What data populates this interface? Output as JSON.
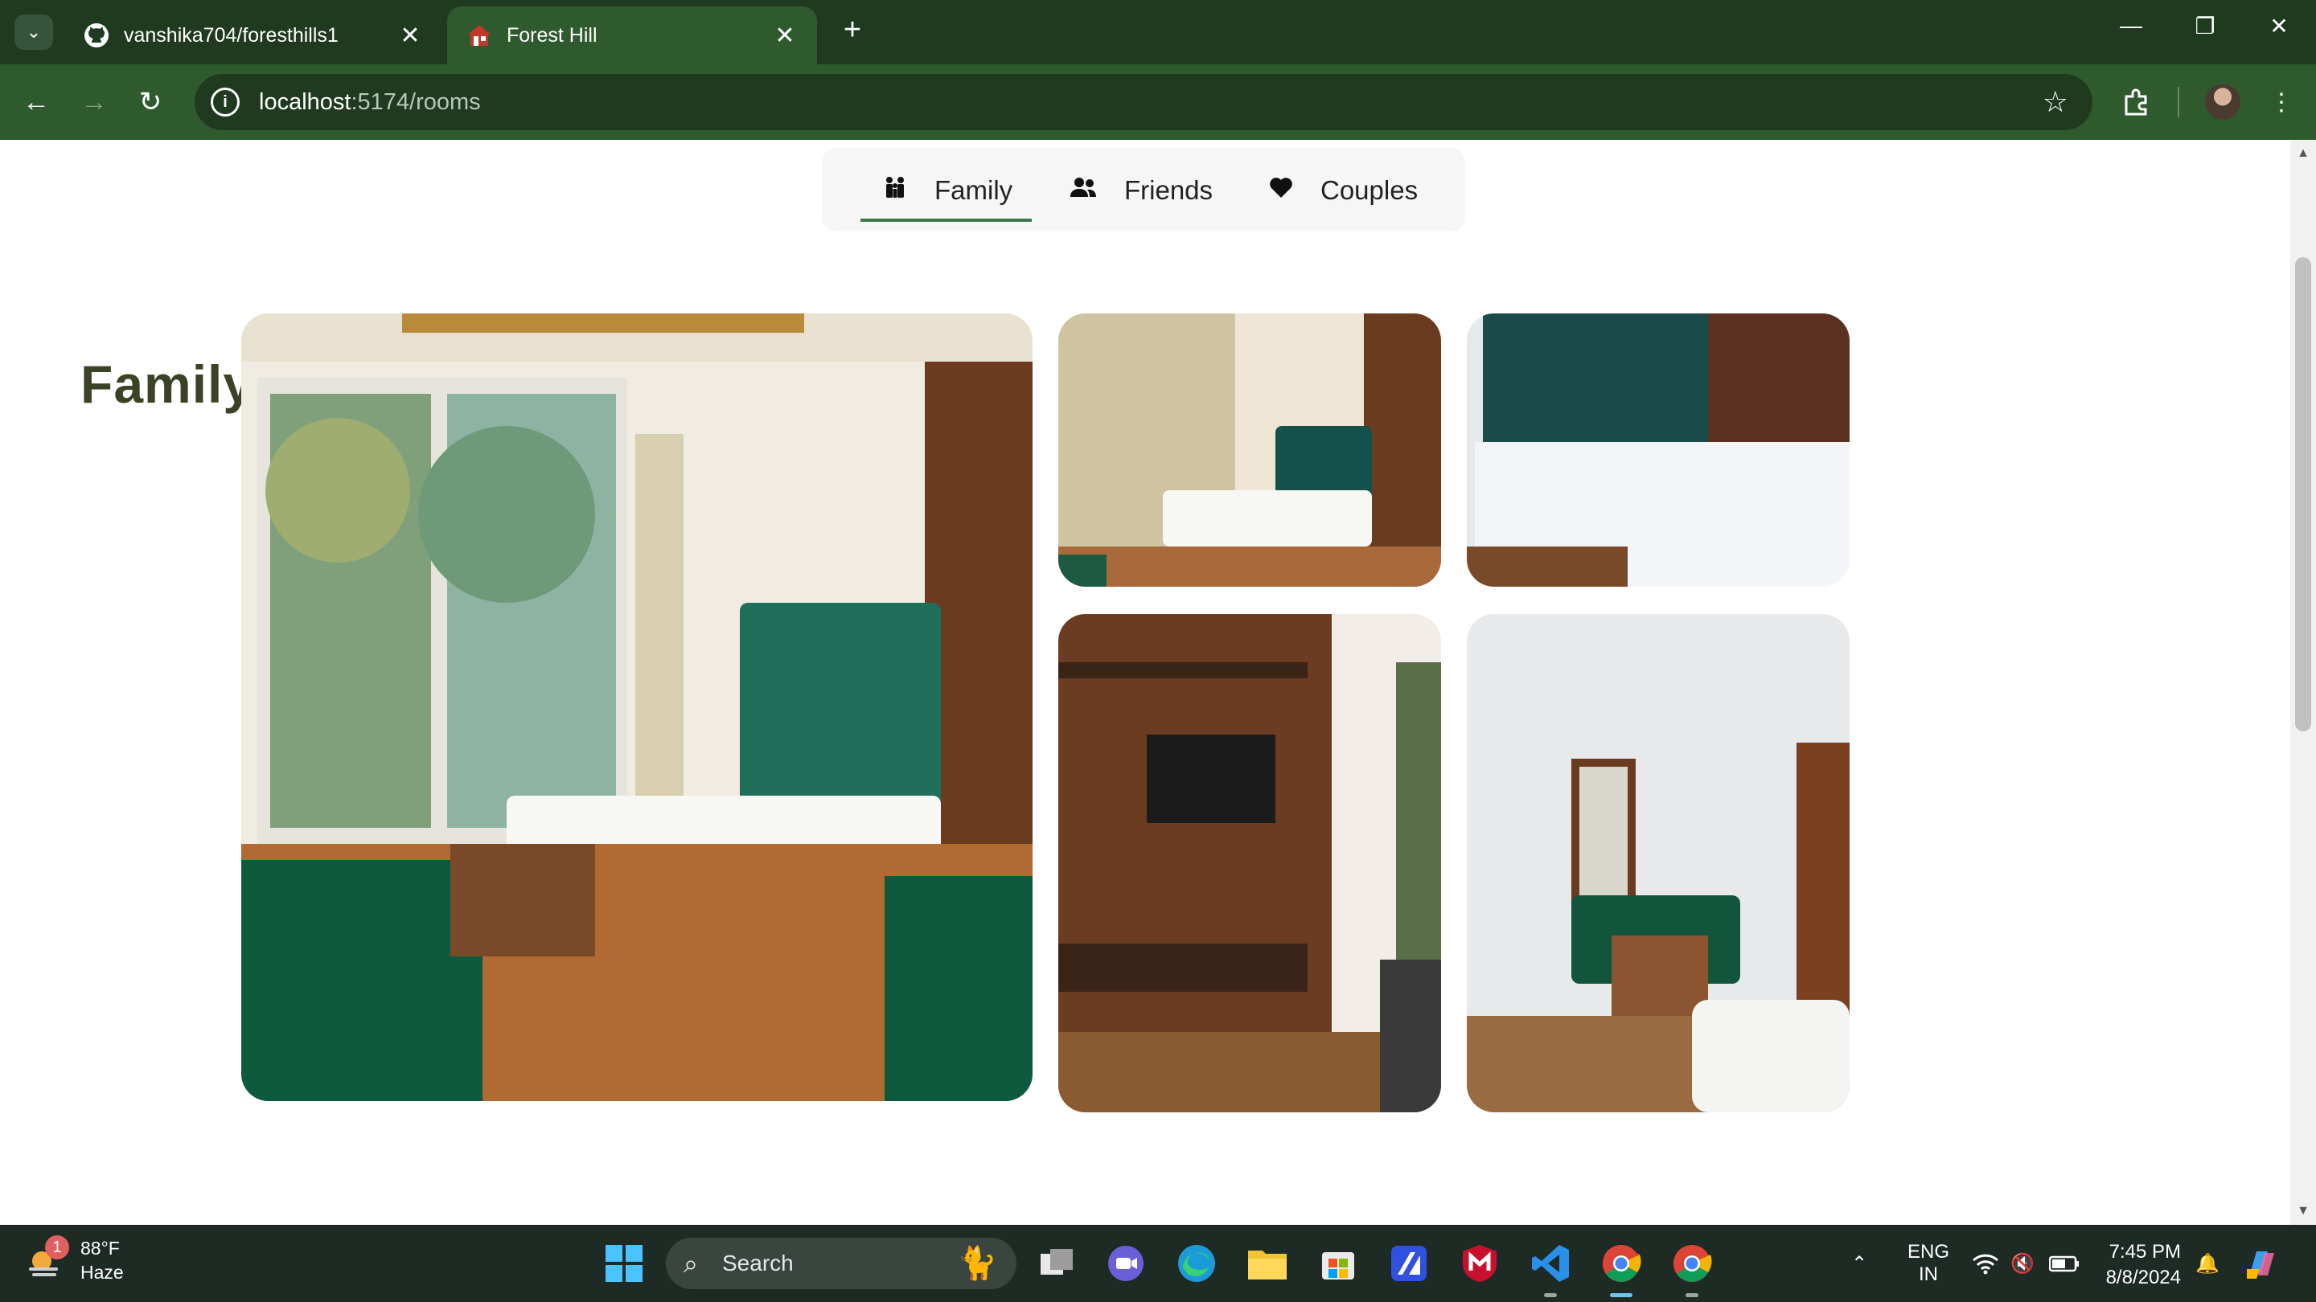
{
  "browser": {
    "tabs": [
      {
        "title": "vanshika704/foresthills1",
        "favicon": "github-icon",
        "active": false
      },
      {
        "title": "Forest Hill",
        "favicon": "house-icon",
        "active": true
      }
    ],
    "url_host": "localhost",
    "url_path": ":5174/rooms",
    "theme_color": "#2e5a2e"
  },
  "page": {
    "category_tabs": [
      {
        "label": "Family",
        "icon": "family-icon",
        "active": true
      },
      {
        "label": "Friends",
        "icon": "users-icon",
        "active": false
      },
      {
        "label": "Couples",
        "icon": "heart-icon",
        "active": false
      }
    ],
    "room_title": "Family Deluxe Room",
    "photos": [
      "bedroom-main-photo",
      "bedroom-curtains-photo",
      "bed-closeup-photo",
      "tv-wall-photo",
      "mirror-sofa-photo"
    ],
    "title_color": "#3b4326",
    "accent_color": "#3d7a4a"
  },
  "taskbar": {
    "weather_badge": "1",
    "weather_temp": "88°F",
    "weather_desc": "Haze",
    "search_placeholder": "Search",
    "lang_primary": "ENG",
    "lang_secondary": "IN",
    "time": "7:45 PM",
    "date": "8/8/2024"
  }
}
